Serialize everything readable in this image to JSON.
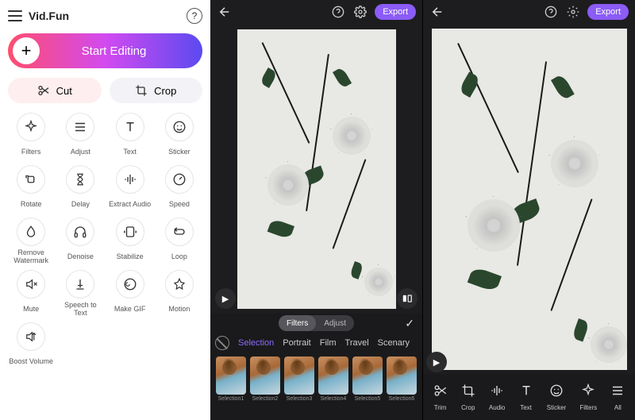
{
  "app": {
    "brand": "Vid.Fun",
    "start_label": "Start Editing"
  },
  "primary_tabs": {
    "cut": "Cut",
    "crop": "Crop"
  },
  "tools": [
    {
      "id": "filters",
      "label": "Filters",
      "icon": "sparkle"
    },
    {
      "id": "adjust",
      "label": "Adjust",
      "icon": "lines"
    },
    {
      "id": "text",
      "label": "Text",
      "icon": "T"
    },
    {
      "id": "sticker",
      "label": "Sticker",
      "icon": "smile"
    },
    {
      "id": "rotate",
      "label": "Rotate",
      "icon": "rotate"
    },
    {
      "id": "delay",
      "label": "Delay",
      "icon": "hourglass"
    },
    {
      "id": "extract",
      "label": "Extract Audio",
      "icon": "audio"
    },
    {
      "id": "speed",
      "label": "Speed",
      "icon": "gauge"
    },
    {
      "id": "watermark",
      "label": "Remove Watermark",
      "icon": "drop"
    },
    {
      "id": "denoise",
      "label": "Denoise",
      "icon": "headphones"
    },
    {
      "id": "stabilize",
      "label": "Stabilize",
      "icon": "stabilize"
    },
    {
      "id": "loop",
      "label": "Loop",
      "icon": "loop"
    },
    {
      "id": "mute",
      "label": "Mute",
      "icon": "mute"
    },
    {
      "id": "stt",
      "label": "Speech to Text",
      "icon": "stt"
    },
    {
      "id": "gif",
      "label": "Make GIF",
      "icon": "gif"
    },
    {
      "id": "motion",
      "label": "Motion",
      "icon": "star"
    },
    {
      "id": "boost",
      "label": "Boost Volume",
      "icon": "boost"
    }
  ],
  "editor": {
    "export_label": "Export"
  },
  "filter_panel": {
    "mode_filters": "Filters",
    "mode_adjust": "Adjust",
    "categories": [
      "Selection",
      "Portrait",
      "Film",
      "Travel",
      "Scenary"
    ],
    "active_category": "Selection",
    "thumbs": [
      "Selection1",
      "Selection2",
      "Selection3",
      "Selection4",
      "Selection5",
      "Selection6"
    ]
  },
  "bottom_tools": [
    {
      "id": "trim",
      "label": "Trim",
      "icon": "scissors"
    },
    {
      "id": "crop",
      "label": "Crop",
      "icon": "crop"
    },
    {
      "id": "audio",
      "label": "Audio",
      "icon": "audio"
    },
    {
      "id": "text",
      "label": "Text",
      "icon": "T"
    },
    {
      "id": "sticker",
      "label": "Sticker",
      "icon": "smile"
    },
    {
      "id": "filters",
      "label": "Filters",
      "icon": "sparkle"
    },
    {
      "id": "all",
      "label": "All",
      "icon": "lines"
    }
  ]
}
